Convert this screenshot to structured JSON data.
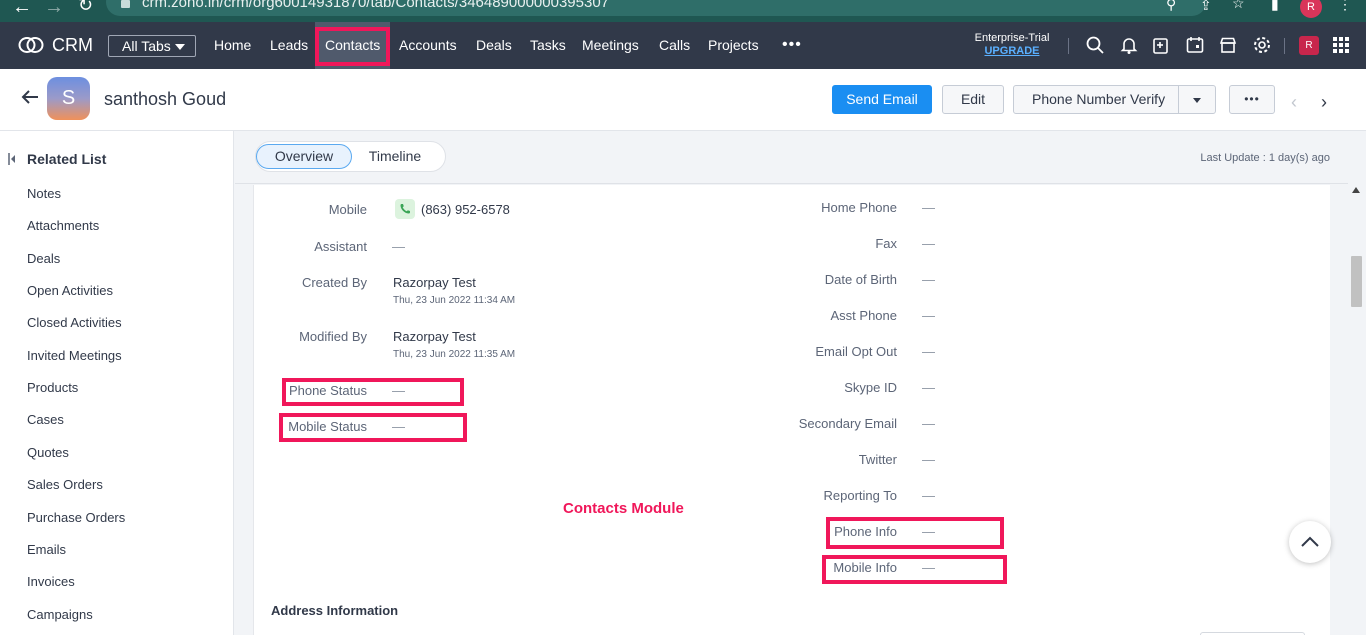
{
  "browser": {
    "url": "crm.zoho.in/crm/org60014931870/tab/Contacts/346489000000395307",
    "profile_initial": "R"
  },
  "topnav": {
    "brand": "CRM",
    "all_tabs": "All Tabs",
    "tabs": [
      "Home",
      "Leads",
      "Contacts",
      "Accounts",
      "Deals",
      "Tasks",
      "Meetings",
      "Calls",
      "Projects"
    ],
    "active_tab": "Contacts",
    "more": "•••",
    "edition": "Enterprise-Trial",
    "upgrade": "UPGRADE",
    "user_initial": "R"
  },
  "record": {
    "avatar_initial": "S",
    "name": "santhosh Goud",
    "buttons": {
      "send_email": "Send Email",
      "edit": "Edit",
      "phone_verify": "Phone Number Verify",
      "more": "•••"
    },
    "pager_prev": "‹",
    "pager_next": "›"
  },
  "related_list": {
    "title": "Related List",
    "items": [
      "Notes",
      "Attachments",
      "Deals",
      "Open Activities",
      "Closed Activities",
      "Invited Meetings",
      "Products",
      "Cases",
      "Quotes",
      "Sales Orders",
      "Purchase Orders",
      "Emails",
      "Invoices",
      "Campaigns"
    ]
  },
  "view": {
    "tabs": [
      "Overview",
      "Timeline"
    ],
    "active": "Overview",
    "last_update": "Last Update : 1 day(s) ago"
  },
  "fields_left": {
    "mobile": {
      "label": "Mobile",
      "value": "(863) 952-6578"
    },
    "assistant": {
      "label": "Assistant",
      "value": "—"
    },
    "created_by": {
      "label": "Created By",
      "value": "Razorpay Test",
      "time": "Thu, 23 Jun 2022 11:34 AM"
    },
    "modified_by": {
      "label": "Modified By",
      "value": "Razorpay Test",
      "time": "Thu, 23 Jun 2022 11:35 AM"
    },
    "phone_status": {
      "label": "Phone Status",
      "value": "—"
    },
    "mobile_status": {
      "label": "Mobile Status",
      "value": "—"
    }
  },
  "fields_right": [
    {
      "label": "Home Phone",
      "value": "—"
    },
    {
      "label": "Fax",
      "value": "—"
    },
    {
      "label": "Date of Birth",
      "value": "—"
    },
    {
      "label": "Asst Phone",
      "value": "—"
    },
    {
      "label": "Email Opt Out",
      "value": "—"
    },
    {
      "label": "Skype ID",
      "value": "—"
    },
    {
      "label": "Secondary Email",
      "value": "—"
    },
    {
      "label": "Twitter",
      "value": "—"
    },
    {
      "label": "Reporting To",
      "value": "—"
    },
    {
      "label": "Phone Info",
      "value": "—"
    },
    {
      "label": "Mobile Info",
      "value": "—"
    }
  ],
  "annotation": {
    "module_label": "Contacts Module",
    "highlight_color": "#f0175a"
  },
  "section": {
    "address_title": "Address Information"
  },
  "colors": {
    "nav_bg": "#313949",
    "primary": "#1a8ef2",
    "browser_bar": "#1f5752"
  }
}
